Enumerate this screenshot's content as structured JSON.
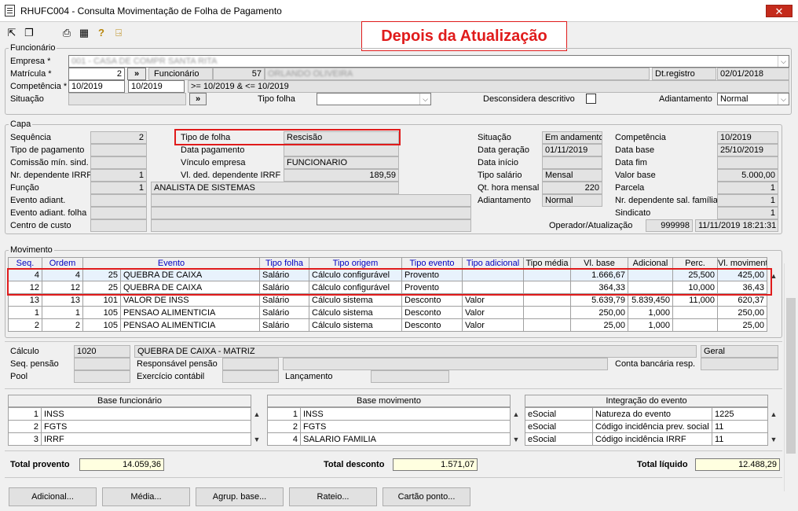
{
  "window": {
    "title": "RHUFC004 - Consulta Movimentação de Folha de Pagamento",
    "close": "✕"
  },
  "banner": "Depois da Atualização",
  "funcionario": {
    "group": "Funcionário",
    "empresa_label": "Empresa *",
    "empresa_value": "001 - CASA DE COMPR SANTA RITA",
    "matricula_label": "Matrícula *",
    "matricula_value": "2",
    "funcionario_btn": "Funcionário",
    "funcionario_num": "57",
    "funcionario_nome": "ORLANDO OLIVEIRA",
    "dtregistro_label": "Dt.registro",
    "dtregistro_value": "02/01/2018",
    "competencia_label": "Competência *",
    "comp_ini": "10/2019",
    "comp_fim": "10/2019",
    "comp_desc": ">= 10/2019  & <= 10/2019",
    "situacao_label": "Situação",
    "tipofolha_label": "Tipo folha",
    "desconsidera_label": "Desconsidera descritivo",
    "adiantamento_label": "Adiantamento",
    "adiantamento_value": "Normal",
    "more_btn": "»"
  },
  "capa": {
    "group": "Capa",
    "sequencia_label": "Sequência",
    "sequencia_value": "2",
    "tipopag_label": "Tipo de pagamento",
    "comissao_label": "Comissão mín. sind.",
    "nrdep_label": "Nr. dependente IRRF",
    "nrdep_value": "1",
    "funcao_label": "Função",
    "funcao_num": "1",
    "funcao_nome": "ANALISTA DE SISTEMAS",
    "evadiant_label": "Evento adiant.",
    "evadiantfolha_label": "Evento adiant. folha",
    "centro_label": "Centro de custo",
    "tipofolha_label": "Tipo de folha",
    "tipofolha_value": "Rescisão",
    "datapag_label": "Data pagamento",
    "vinculo_label": "Vínculo empresa",
    "vinculo_value": "FUNCIONARIO",
    "vldep_label": "Vl. ded. dependente IRRF",
    "vldep_value": "189,59",
    "situacao_label": "Situação",
    "situacao_value": "Em andamento",
    "datager_label": "Data geração",
    "datager_value": "01/11/2019",
    "datainicio_label": "Data início",
    "tiposal_label": "Tipo salário",
    "tiposal_value": "Mensal",
    "qthora_label": "Qt. hora mensal",
    "qthora_value": "220",
    "adiant_label": "Adiantamento",
    "adiant_value": "Normal",
    "competencia_label": "Competência",
    "competencia_value": "10/2019",
    "database_label": "Data base",
    "database_value": "25/10/2019",
    "datafim_label": "Data fim",
    "valorbase_label": "Valor base",
    "valorbase_value": "5.000,00",
    "parcela_label": "Parcela",
    "parcela_value": "1",
    "nrdepfam_label": "Nr. dependente sal. família",
    "nrdepfam_value": "1",
    "sindicato_label": "Sindicato",
    "sindicato_value": "1",
    "operador_label": "Operador/Atualização",
    "operador_value": "999998",
    "operador_data": "11/11/2019 18:21:31"
  },
  "movimento": {
    "group": "Movimento",
    "headers": [
      "Seq.",
      "Ordem",
      "Evento",
      "Tipo folha",
      "Tipo origem",
      "Tipo evento",
      "Tipo adicional",
      "Tipo média",
      "Vl. base",
      "Adicional",
      "Perc.",
      "Vl. movimento"
    ],
    "rows": [
      [
        "4",
        "4",
        "25",
        "QUEBRA DE CAIXA",
        "Salário",
        "Cálculo configurável",
        "Provento",
        "",
        "",
        "1.666,67",
        "",
        "25,500",
        "425,00"
      ],
      [
        "12",
        "12",
        "25",
        "QUEBRA DE CAIXA",
        "Salário",
        "Cálculo configurável",
        "Provento",
        "",
        "",
        "364,33",
        "",
        "10,000",
        "36,43"
      ],
      [
        "13",
        "13",
        "101",
        "VALOR DE INSS",
        "Salário",
        "Cálculo sistema",
        "Desconto",
        "Valor",
        "",
        "5.639,79",
        "5.839,450",
        "11,000",
        "620,37"
      ],
      [
        "1",
        "1",
        "105",
        "PENSAO ALIMENTICIA",
        "Salário",
        "Cálculo sistema",
        "Desconto",
        "Valor",
        "",
        "250,00",
        "1,000",
        "",
        "250,00"
      ],
      [
        "2",
        "2",
        "105",
        "PENSAO ALIMENTICIA",
        "Salário",
        "Cálculo sistema",
        "Desconto",
        "Valor",
        "",
        "25,00",
        "1,000",
        "",
        "25,00"
      ]
    ]
  },
  "calculo": {
    "calculo_label": "Cálculo",
    "calculo_value": "1020",
    "calculo_desc": "QUEBRA DE CAIXA - MATRIZ",
    "calculo_tipo": "Geral",
    "seqpensao_label": "Seq. pensão",
    "responsavel_label": "Responsável pensão",
    "conta_label": "Conta bancária resp.",
    "pool_label": "Pool",
    "exercicio_label": "Exercício contábil",
    "lancamento_label": "Lançamento"
  },
  "bases": {
    "funcionario_title": "Base funcionário",
    "funcionario_rows": [
      [
        "1",
        "INSS"
      ],
      [
        "2",
        "FGTS"
      ],
      [
        "3",
        "IRRF"
      ]
    ],
    "movimento_title": "Base movimento",
    "movimento_rows": [
      [
        "1",
        "INSS"
      ],
      [
        "2",
        "FGTS"
      ],
      [
        "4",
        "SALARIO FAMILIA"
      ]
    ],
    "integracao_title": "Integração do evento",
    "integracao_rows": [
      [
        "eSocial",
        "Natureza do evento",
        "1225"
      ],
      [
        "eSocial",
        "Código incidência prev. social",
        "11"
      ],
      [
        "eSocial",
        "Código incidência IRRF",
        "11"
      ]
    ]
  },
  "totais": {
    "provento_label": "Total provento",
    "provento_value": "14.059,36",
    "desconto_label": "Total desconto",
    "desconto_value": "1.571,07",
    "liquido_label": "Total líquido",
    "liquido_value": "12.488,29"
  },
  "buttons": {
    "adicional": "Adicional...",
    "media": "Média...",
    "agrup": "Agrup. base...",
    "rateio": "Rateio...",
    "cartao": "Cartão ponto..."
  },
  "icons": {
    "cor_borda": "#e01b1b",
    "cor_selecao": "#e8f2fc",
    "cor_total": "#ffffe0"
  }
}
